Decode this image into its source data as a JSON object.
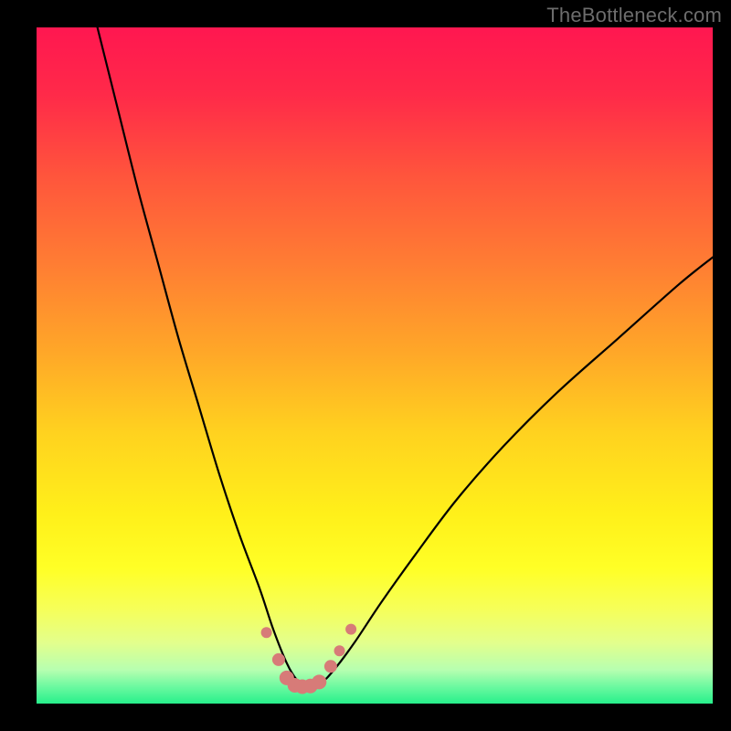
{
  "watermark": "TheBottleneck.com",
  "colors": {
    "frame": "#000000",
    "curve": "#000000",
    "dot_fill": "#d77b78",
    "bottom_strip": "#27f08b",
    "gradient_stops": [
      {
        "offset": 0.0,
        "color": "#ff1750"
      },
      {
        "offset": 0.1,
        "color": "#ff2a49"
      },
      {
        "offset": 0.22,
        "color": "#ff553c"
      },
      {
        "offset": 0.35,
        "color": "#ff7d33"
      },
      {
        "offset": 0.48,
        "color": "#ffa728"
      },
      {
        "offset": 0.6,
        "color": "#ffd21f"
      },
      {
        "offset": 0.72,
        "color": "#fff01a"
      },
      {
        "offset": 0.8,
        "color": "#ffff26"
      },
      {
        "offset": 0.86,
        "color": "#f6ff59"
      },
      {
        "offset": 0.91,
        "color": "#e3ff8c"
      },
      {
        "offset": 0.95,
        "color": "#b7ffb0"
      },
      {
        "offset": 0.975,
        "color": "#6cf9a0"
      },
      {
        "offset": 1.0,
        "color": "#27f08b"
      }
    ]
  },
  "chart_data": {
    "type": "line",
    "title": "",
    "xlabel": "",
    "ylabel": "",
    "xlim": [
      0,
      100
    ],
    "ylim": [
      0,
      100
    ],
    "legend": false,
    "grid": false,
    "annotations": [
      {
        "text": "TheBottleneck.com",
        "pos": "top-right"
      }
    ],
    "series": [
      {
        "name": "bottleneck-curve",
        "x": [
          9,
          12,
          15,
          18,
          21,
          24,
          27,
          30,
          33,
          35,
          37,
          38.5,
          40,
          42,
          44,
          47,
          51,
          56,
          62,
          69,
          77,
          86,
          95,
          100
        ],
        "y": [
          100,
          88,
          76,
          65,
          54,
          44,
          34,
          25,
          17,
          11,
          6,
          3.5,
          2.5,
          3,
          5,
          9,
          15,
          22,
          30,
          38,
          46,
          54,
          62,
          66
        ]
      }
    ],
    "points_overlay": {
      "name": "highlight-dots",
      "x": [
        34.0,
        35.8,
        37.0,
        38.2,
        39.3,
        40.5,
        41.8,
        43.5,
        44.8,
        46.5
      ],
      "y": [
        10.5,
        6.5,
        3.8,
        2.7,
        2.5,
        2.6,
        3.2,
        5.5,
        7.8,
        11.0
      ],
      "r": [
        6,
        7,
        8,
        8,
        8,
        8,
        8,
        7,
        6,
        6
      ]
    }
  }
}
